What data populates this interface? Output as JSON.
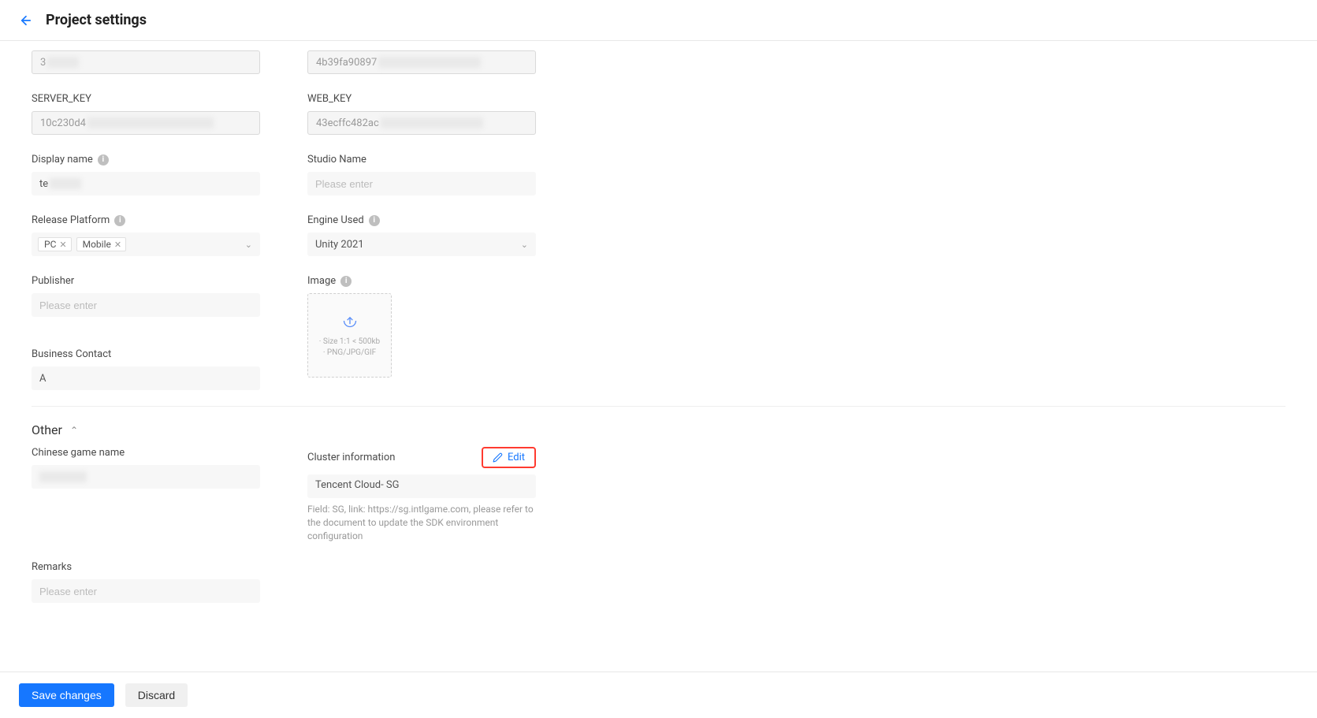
{
  "header": {
    "title": "Project settings"
  },
  "fields": {
    "id": {
      "value": "3"
    },
    "app_secret": {
      "value": "4b39fa90897"
    },
    "server_key": {
      "label": "SERVER_KEY",
      "value": "10c230d4"
    },
    "web_key": {
      "label": "WEB_KEY",
      "value": "43ecffc482ac"
    },
    "display_name": {
      "label": "Display name",
      "value": "te"
    },
    "studio_name": {
      "label": "Studio Name",
      "placeholder": "Please enter"
    },
    "release_platform": {
      "label": "Release Platform",
      "tags": [
        "PC",
        "Mobile"
      ]
    },
    "engine_used": {
      "label": "Engine Used",
      "value": "Unity 2021"
    },
    "publisher": {
      "label": "Publisher",
      "placeholder": "Please enter"
    },
    "image": {
      "label": "Image",
      "hint_line1": "· Size 1:1 < 500kb",
      "hint_line2": "· PNG/JPG/GIF"
    },
    "business_contact": {
      "label": "Business Contact",
      "value": "A"
    }
  },
  "other": {
    "title": "Other",
    "chinese_game_name": {
      "label": "Chinese game name"
    },
    "cluster": {
      "label": "Cluster information",
      "edit_label": "Edit",
      "value": "Tencent Cloud- SG",
      "hint": "Field: SG, link: https://sg.intlgame.com, please refer to the document to update the SDK environment configuration"
    },
    "remarks": {
      "label": "Remarks",
      "placeholder": "Please enter"
    }
  },
  "footer": {
    "save": "Save changes",
    "discard": "Discard"
  }
}
